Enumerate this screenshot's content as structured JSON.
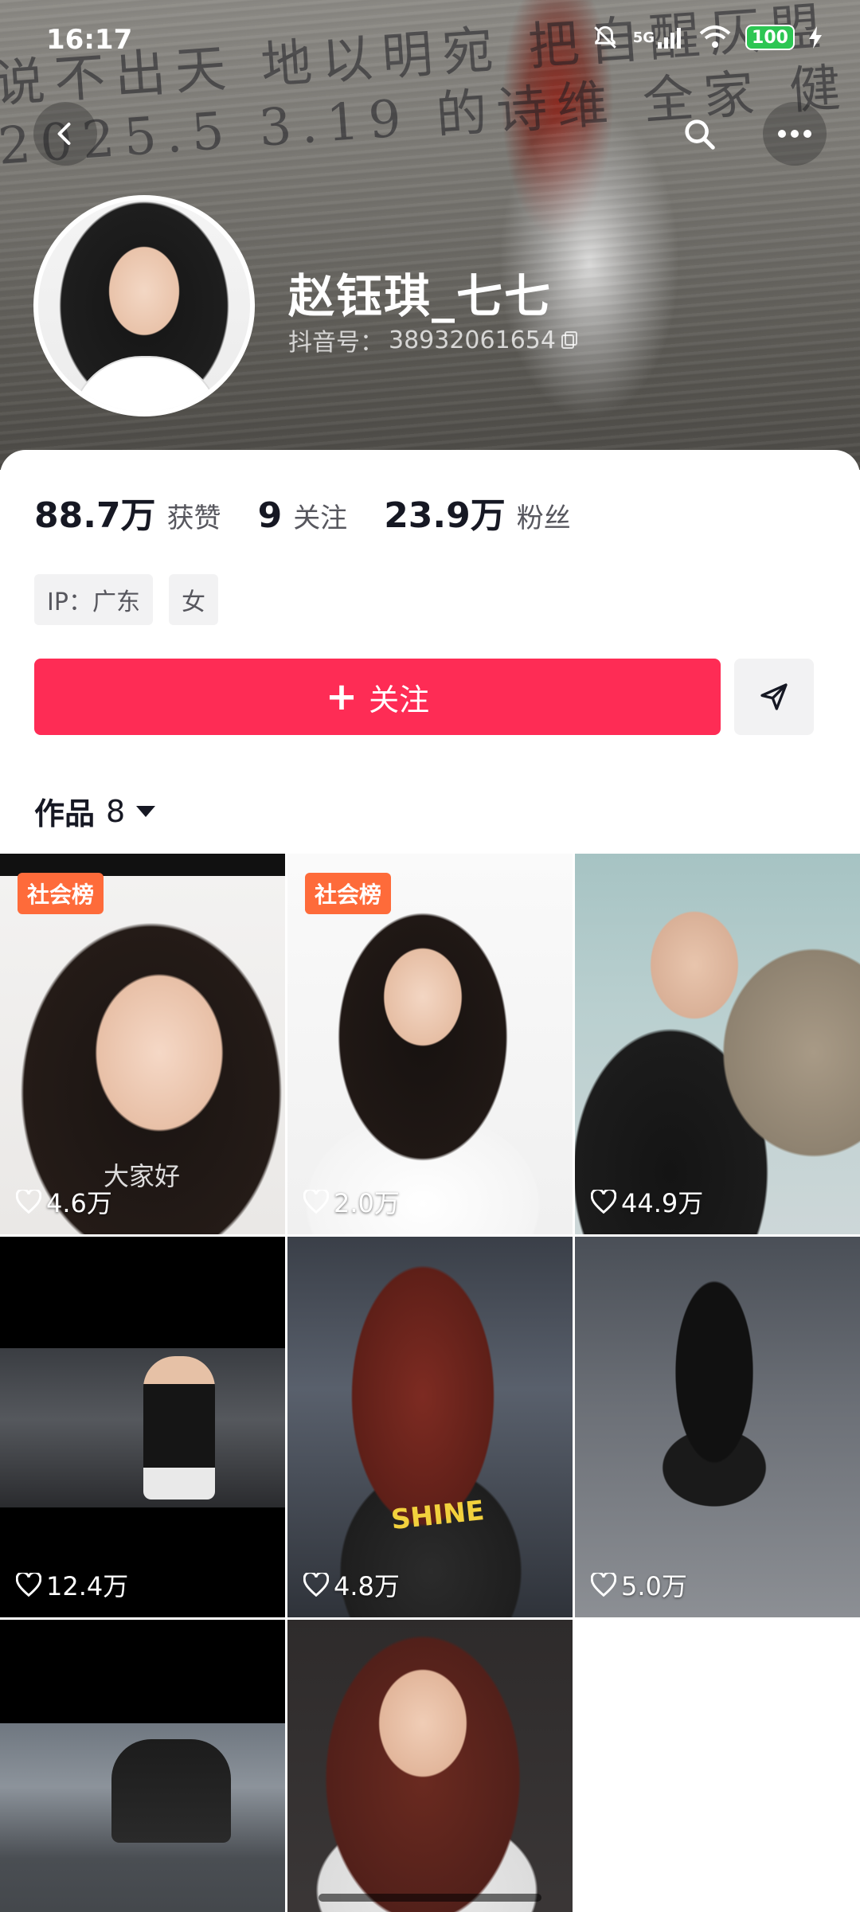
{
  "status_bar": {
    "time": "16:17",
    "network": "5G",
    "battery": "100",
    "icons": [
      "mute-bell-icon",
      "signal-icon",
      "wifi-icon",
      "battery-icon",
      "charging-icon"
    ]
  },
  "header": {
    "icons": [
      "back-arrow-icon",
      "search-icon",
      "more-icon"
    ],
    "cover_scrawl": "说不出天 地以明宛 把自醒仄盟 2025.5 3.19 的诗维 全家 健"
  },
  "profile": {
    "username": "赵钰琪_七七",
    "douyin_id_label": "抖音号：",
    "douyin_id": "38932061654",
    "stats": [
      {
        "value": "88.7万",
        "label": "获赞"
      },
      {
        "value": "9",
        "label": "关注"
      },
      {
        "value": "23.9万",
        "label": "粉丝"
      }
    ],
    "tags": [
      "IP：广东",
      "女"
    ],
    "follow_label": "关注",
    "works_label": "作品",
    "works_count": "8"
  },
  "grid": [
    {
      "badge": "社会榜",
      "likes": "4.6万",
      "caption": "大家好"
    },
    {
      "badge": "社会榜",
      "likes": "2.0万"
    },
    {
      "likes": "44.9万"
    },
    {
      "likes": "12.4万"
    },
    {
      "likes": "4.8万",
      "caption": "SHINE"
    },
    {
      "likes": "5.0万"
    },
    {
      "likes": ""
    },
    {
      "likes": ""
    }
  ],
  "colors": {
    "accent": "#fe2c55",
    "badge": "#fe6b3a",
    "battery": "#2dc653"
  }
}
